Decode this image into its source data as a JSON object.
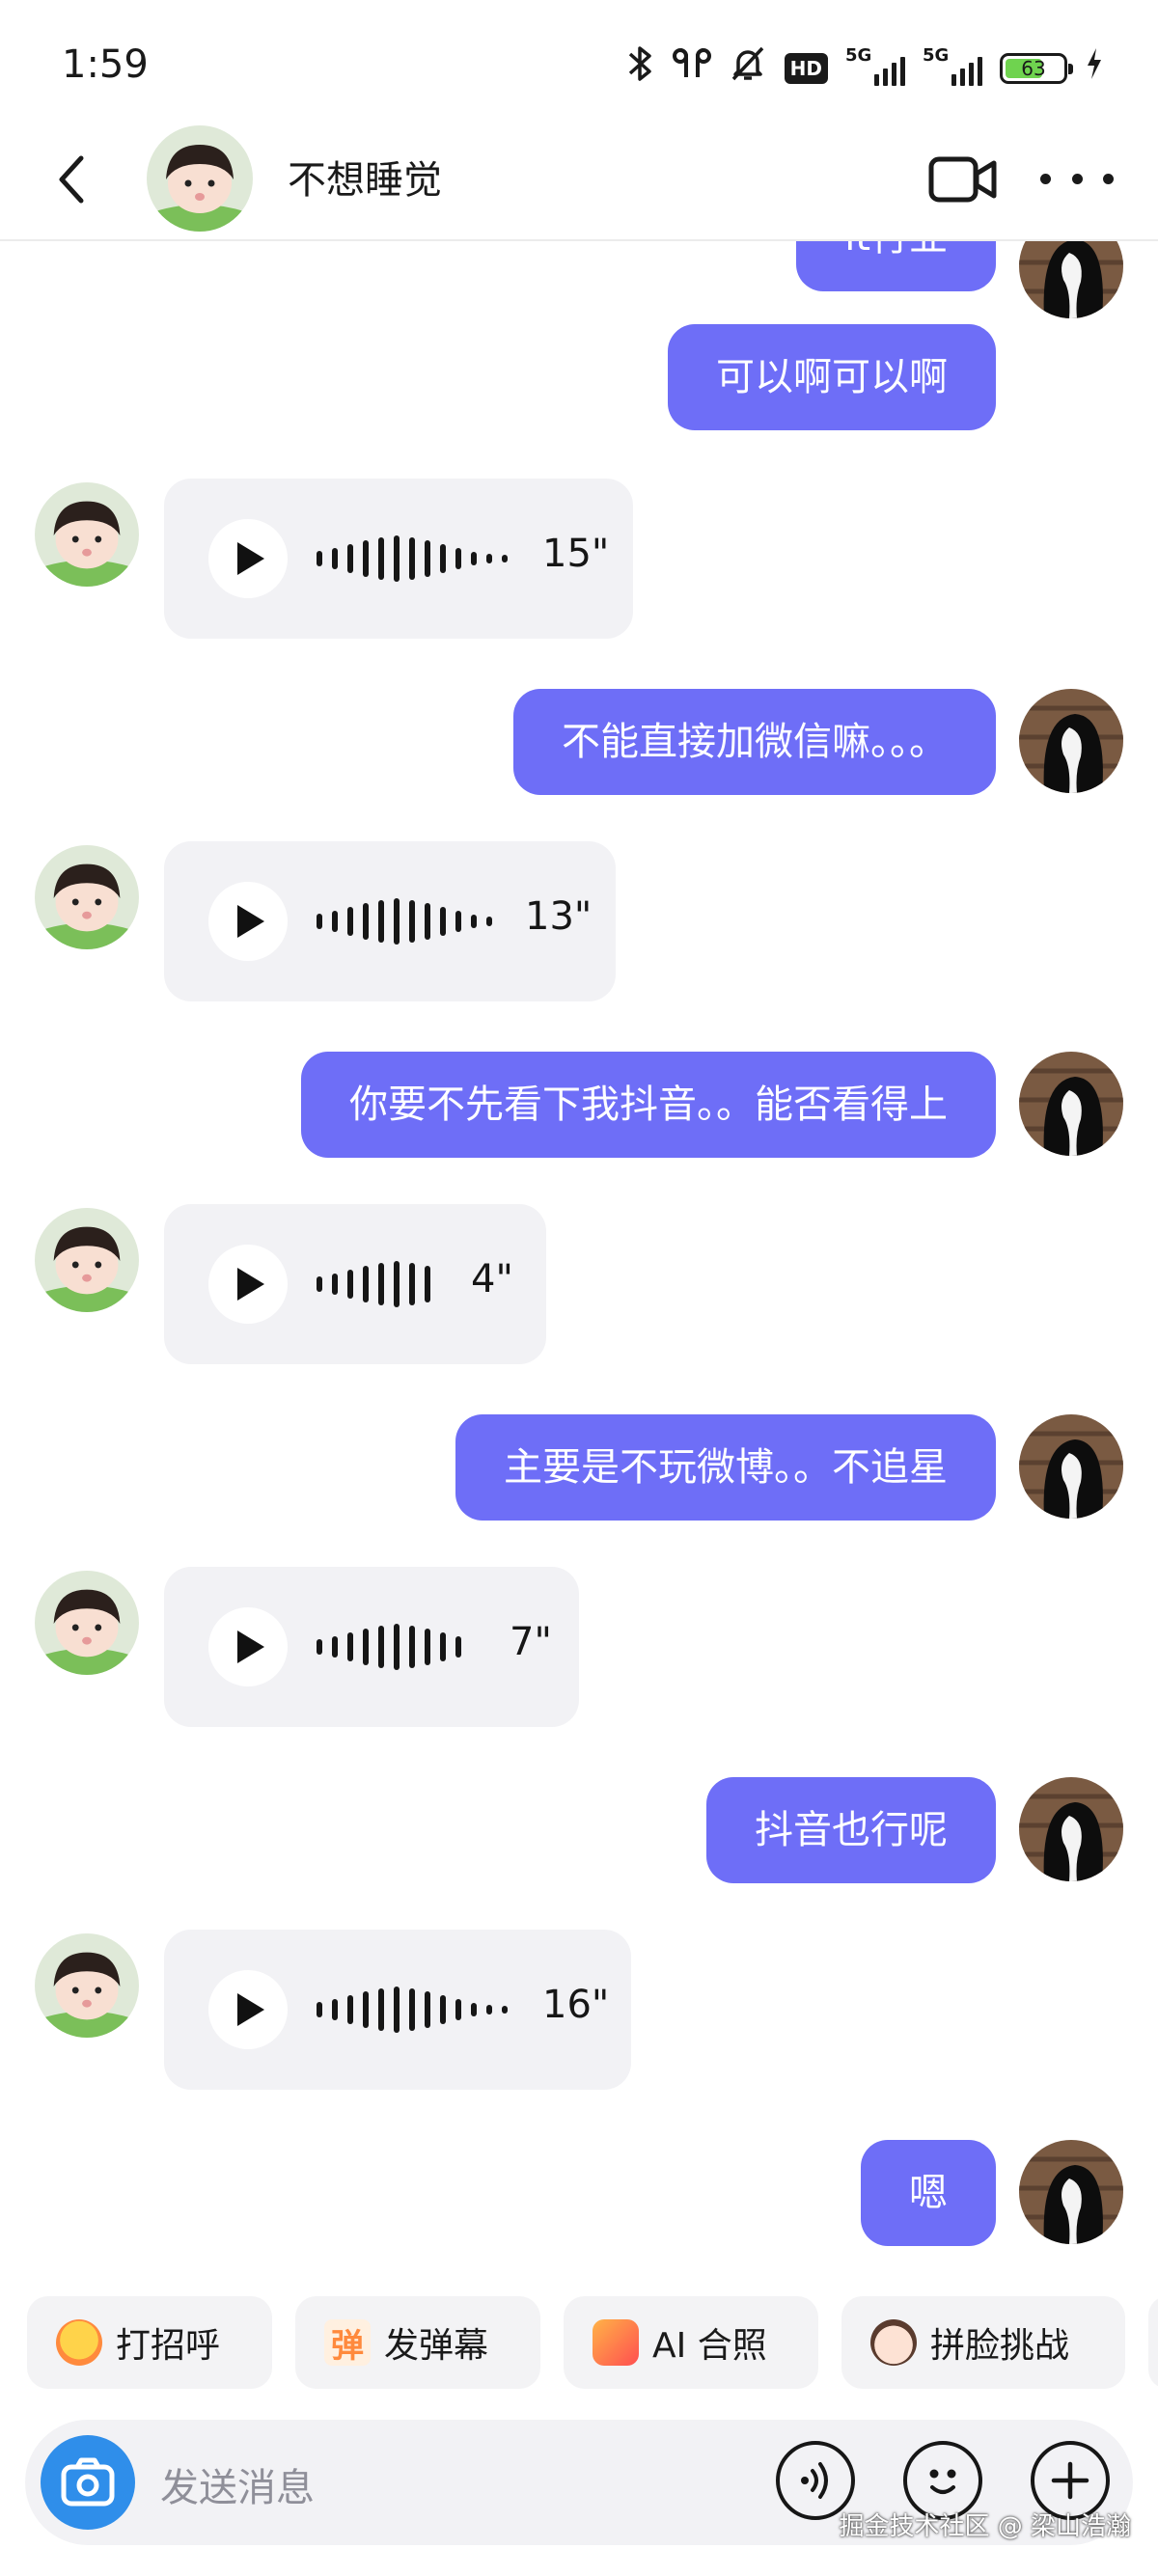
{
  "status_bar": {
    "time": "1:59",
    "network_label": "5G",
    "hd_label": "HD",
    "battery_level": "63"
  },
  "header": {
    "title": "不想睡觉"
  },
  "messages": {
    "m0": "it行业",
    "m1": "可以啊可以啊",
    "v1": "15\"",
    "m2": "不能直接加微信嘛。。。",
    "v2": "13\"",
    "m3": "你要不先看下我抖音。。能否看得上",
    "v3": "4\"",
    "m4": "主要是不玩微博。。不追星",
    "v4": "7\"",
    "m5": "抖音也行呢",
    "v5": "16\"",
    "m6": "嗯"
  },
  "quick_actions": {
    "greet": "打招呼",
    "danmu": "发弹幕",
    "ai_photo": "AI 合照",
    "face_challenge": "拼脸挑战",
    "danmu_icon_text": "弹"
  },
  "input": {
    "placeholder": "发送消息"
  },
  "watermark": "掘金技术社区 @ 梁山浩瀚",
  "colors": {
    "outgoing_bubble": "#6e6ef7",
    "incoming_bubble": "#f2f2f5",
    "camera_button": "#2f8eea"
  }
}
